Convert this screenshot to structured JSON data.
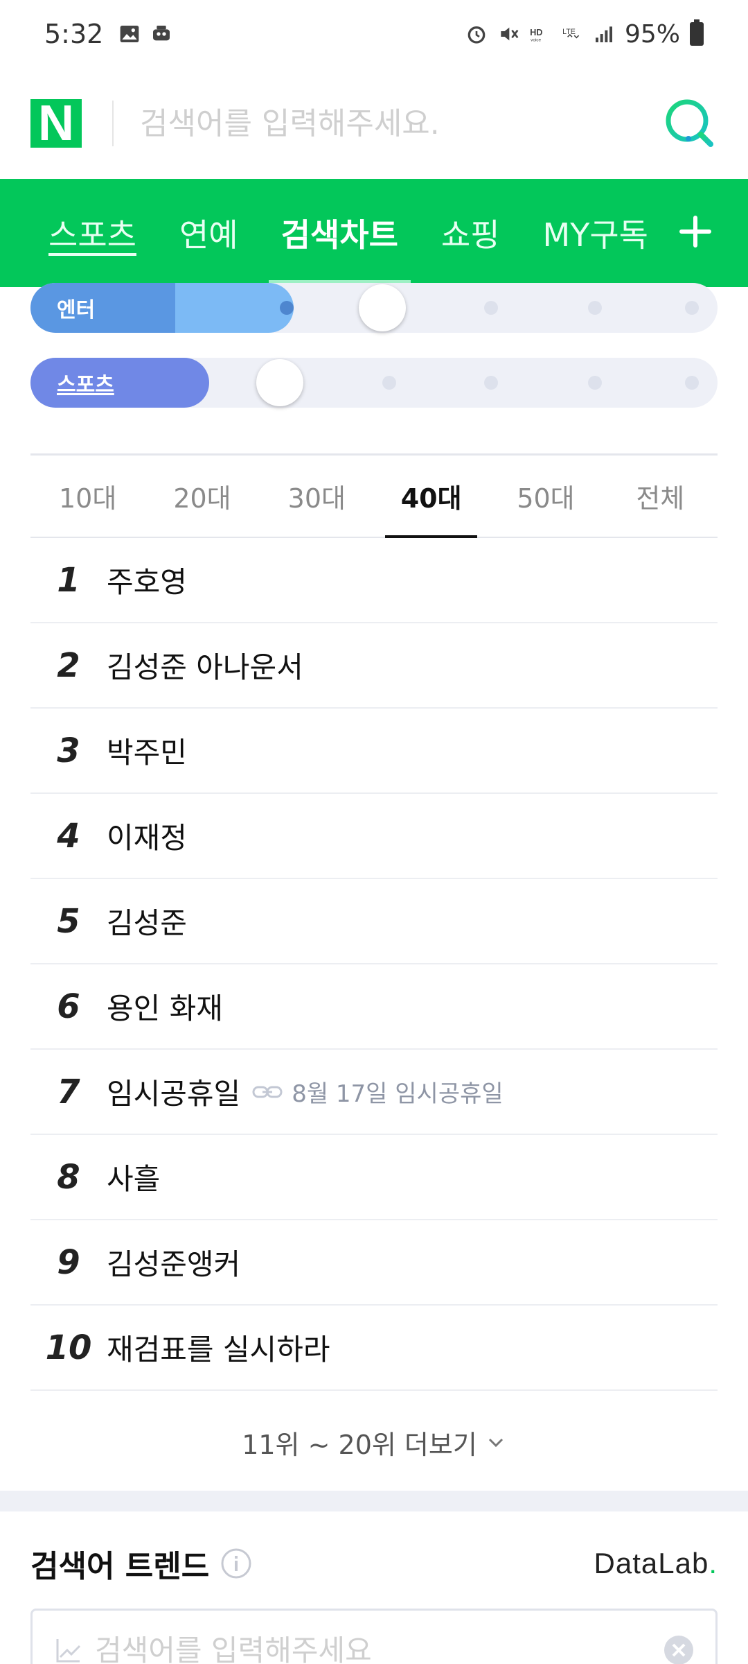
{
  "status_bar": {
    "time": "5:32",
    "battery": "95%"
  },
  "search": {
    "placeholder": "검색어를 입력해주세요."
  },
  "logo": {
    "letter": "N"
  },
  "nav": {
    "tabs": [
      {
        "label": "스포츠"
      },
      {
        "label": "연예"
      },
      {
        "label": "검색차트"
      },
      {
        "label": "쇼핑"
      },
      {
        "label": "MY구독"
      }
    ],
    "active": "검색차트"
  },
  "sliders": [
    {
      "label": "엔터",
      "level": 2,
      "steps": 5,
      "color": "#5b9be6"
    },
    {
      "label": "스포츠",
      "level": 1,
      "steps": 5,
      "color": "#7088e6"
    }
  ],
  "age_tabs": {
    "items": [
      "10대",
      "20대",
      "30대",
      "40대",
      "50대",
      "전체"
    ],
    "active": "40대"
  },
  "ranking": [
    {
      "rank": "1",
      "keyword": "주호영"
    },
    {
      "rank": "2",
      "keyword": "김성준 아나운서"
    },
    {
      "rank": "3",
      "keyword": "박주민"
    },
    {
      "rank": "4",
      "keyword": "이재정"
    },
    {
      "rank": "5",
      "keyword": "김성준"
    },
    {
      "rank": "6",
      "keyword": "용인 화재"
    },
    {
      "rank": "7",
      "keyword": "임시공휴일",
      "related": "8월 17일 임시공휴일"
    },
    {
      "rank": "8",
      "keyword": "사흘"
    },
    {
      "rank": "9",
      "keyword": "김성준앵커"
    },
    {
      "rank": "10",
      "keyword": "재검표를 실시하라"
    }
  ],
  "more": {
    "label": "11위 ~ 20위 더보기"
  },
  "trend": {
    "title": "검색어 트렌드",
    "brand": "DataLab",
    "brand_dot": ".",
    "placeholder": "검색어를 입력해주세요"
  },
  "colors": {
    "brand_green": "#03c75a",
    "nav_underline": "#9df0c4"
  }
}
